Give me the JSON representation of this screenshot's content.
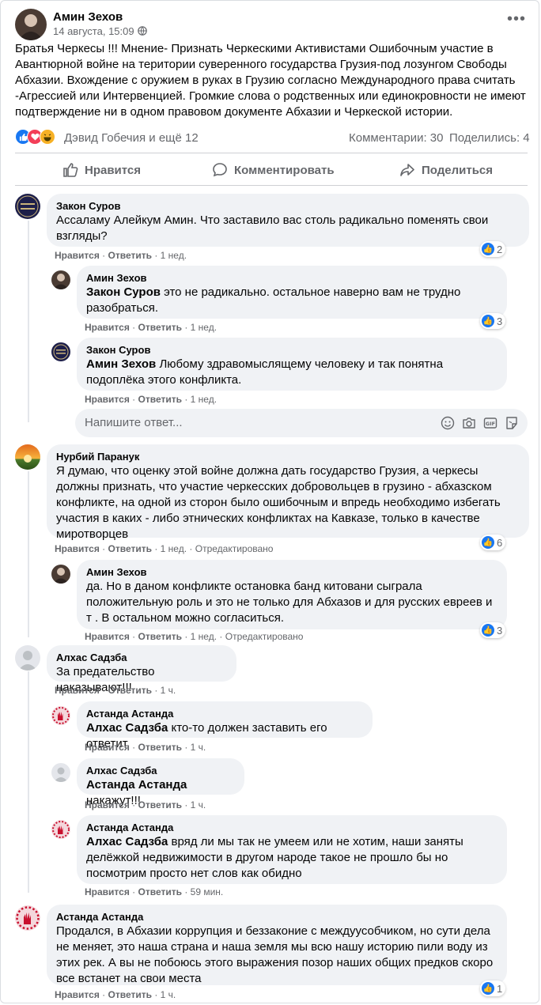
{
  "post": {
    "author": "Амин Зехов",
    "date": "14 августа, 15:09",
    "text": "Братья Черкесы !!! Мнение- Признать Черкескими Активистами Ошибочным участие в Авантюрной войне  на територии суверенного государства Грузия-под лозунгом Свободы Абхазии. Вхождение с оружием в руках в Грузию согласно Международного права считать -Агрессией или Интервенцией. Громкие слова о родственных или единокровности не имеют подтверждение ни в одном правовом документе Абхазии и Черкеской истории.",
    "reactions_text": "Дэвид Гобечия и ещё 12",
    "comments_count": "Комментарии: 30",
    "shares_count": "Поделились: 4",
    "like_btn": "Нравится",
    "comment_btn": "Комментировать",
    "share_btn": "Поделиться"
  },
  "labels": {
    "like": "Нравится",
    "reply": "Ответить",
    "sep": "·",
    "edited": "Отредактировано"
  },
  "reply_box": {
    "placeholder": "Напишите ответ..."
  },
  "comments": [
    {
      "author": "Закон Суров",
      "mention": "",
      "text": "Ассаламу Алейкум Амин. Что заставило вас столь радикально поменять свои взгляды?",
      "time": "1 нед.",
      "likes": "2"
    },
    {
      "author": "Амин Зехов",
      "mention": "Закон Суров",
      "text": " это не радикально. остальное наверно вам не трудно разобраться.",
      "time": "1 нед.",
      "likes": "3"
    },
    {
      "author": "Закон Суров",
      "mention": "Амин Зехов",
      "text": " Любому здравомыслящему человеку и так понятна подоплёка этого конфликта.",
      "time": "1 нед.",
      "likes": ""
    },
    {
      "author": "Нурбий Паранук",
      "mention": "",
      "text": "Я думаю, что оценку этой войне должна дать государство Грузия, а черкесы должны признать, что участие черкесских добровольцев в грузино - абхазском конфликте, на одной из сторон было ошибочным и впредь необходимо избегать участия в каких - либо этнических конфликтах на Кавказе, только в качестве миротворцев",
      "time": "1 нед.",
      "likes": "6"
    },
    {
      "author": "Амин Зехов",
      "mention": "",
      "text": "да. Но в даном конфликте остановка банд китовани сыграла положительную роль и это не только для Абхазов и для русских евреев и т . В остальном можно согласиться.",
      "time": "1 нед.",
      "likes": "3"
    },
    {
      "author": "Алхас Садзба",
      "mention": "",
      "text": "За предательство наказывают!!!",
      "time": "1 ч.",
      "likes": ""
    },
    {
      "author": "Астанда Астанда",
      "mention": "Алхас Садзба",
      "text": " кто-то должен заставить его ответит",
      "time": "1 ч.",
      "likes": ""
    },
    {
      "author": "Алхас Садзба",
      "mention": "Астанда Астанда",
      "text": " накажут!!!",
      "time": "1 ч.",
      "likes": ""
    },
    {
      "author": "Астанда Астанда",
      "mention": "Алхас Садзба",
      "text": " вряд ли мы так не умеем или не хотим, наши заняты делёжкой недвижимости в другом народе такое не прошло бы но посмотрим просто нет слов как обидно",
      "time": "59 мин.",
      "likes": ""
    },
    {
      "author": "Астанда Астанда",
      "mention": "",
      "text": "Продался, в Абхазии коррупция и беззаконие с междуусобчиком, но сути дела не меняет, это наша страна и наша земля мы всю нашу историю пили воду из этих рек. А вы не побоюсь этого выражения позор наших общих предков скоро все встанет на свои места",
      "time": "1 ч.",
      "likes": "1"
    }
  ],
  "colors": {
    "accent": "#1877f2",
    "bubble": "#f0f2f5",
    "secondary_text": "#65676b",
    "love": "#f33e58",
    "haha": "#f7b125"
  },
  "icons": [
    "globe-icon",
    "like-thumb-icon",
    "love-heart-icon",
    "haha-face-icon",
    "comment-icon",
    "share-arrow-icon",
    "smiley-icon",
    "camera-icon",
    "gif-icon",
    "sticker-icon",
    "avatar-default-icon"
  ]
}
